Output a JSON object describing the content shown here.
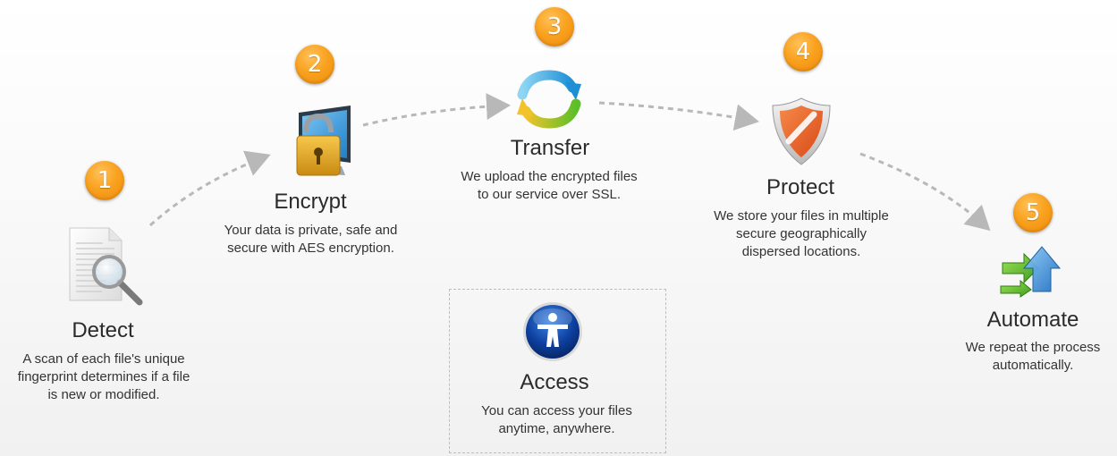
{
  "steps": [
    {
      "number": "1",
      "title": "Detect",
      "desc": "A scan of each file's unique\nfingerprint determines if a file\nis new or modified.",
      "icon": "document-search-icon"
    },
    {
      "number": "2",
      "title": "Encrypt",
      "desc": "Your data is private, safe and\nsecure with AES encryption.",
      "icon": "monitor-lock-icon"
    },
    {
      "number": "3",
      "title": "Transfer",
      "desc": "We upload the encrypted files\nto our service over SSL.",
      "icon": "sync-arrows-icon"
    },
    {
      "number": "4",
      "title": "Protect",
      "desc": "We store your files in multiple\nsecure geographically\ndispersed locations.",
      "icon": "shield-icon"
    },
    {
      "number": "5",
      "title": "Automate",
      "desc": "We repeat the process\nautomatically.",
      "icon": "automate-arrows-icon"
    }
  ],
  "access": {
    "title": "Access",
    "desc": "You can access your files\nanytime, anywhere.",
    "icon": "person-circle-icon"
  },
  "colors": {
    "badge": "#f9a21f",
    "connector": "#b8b8b8",
    "shield": "#e8602a",
    "access": "#0a3f9e"
  }
}
